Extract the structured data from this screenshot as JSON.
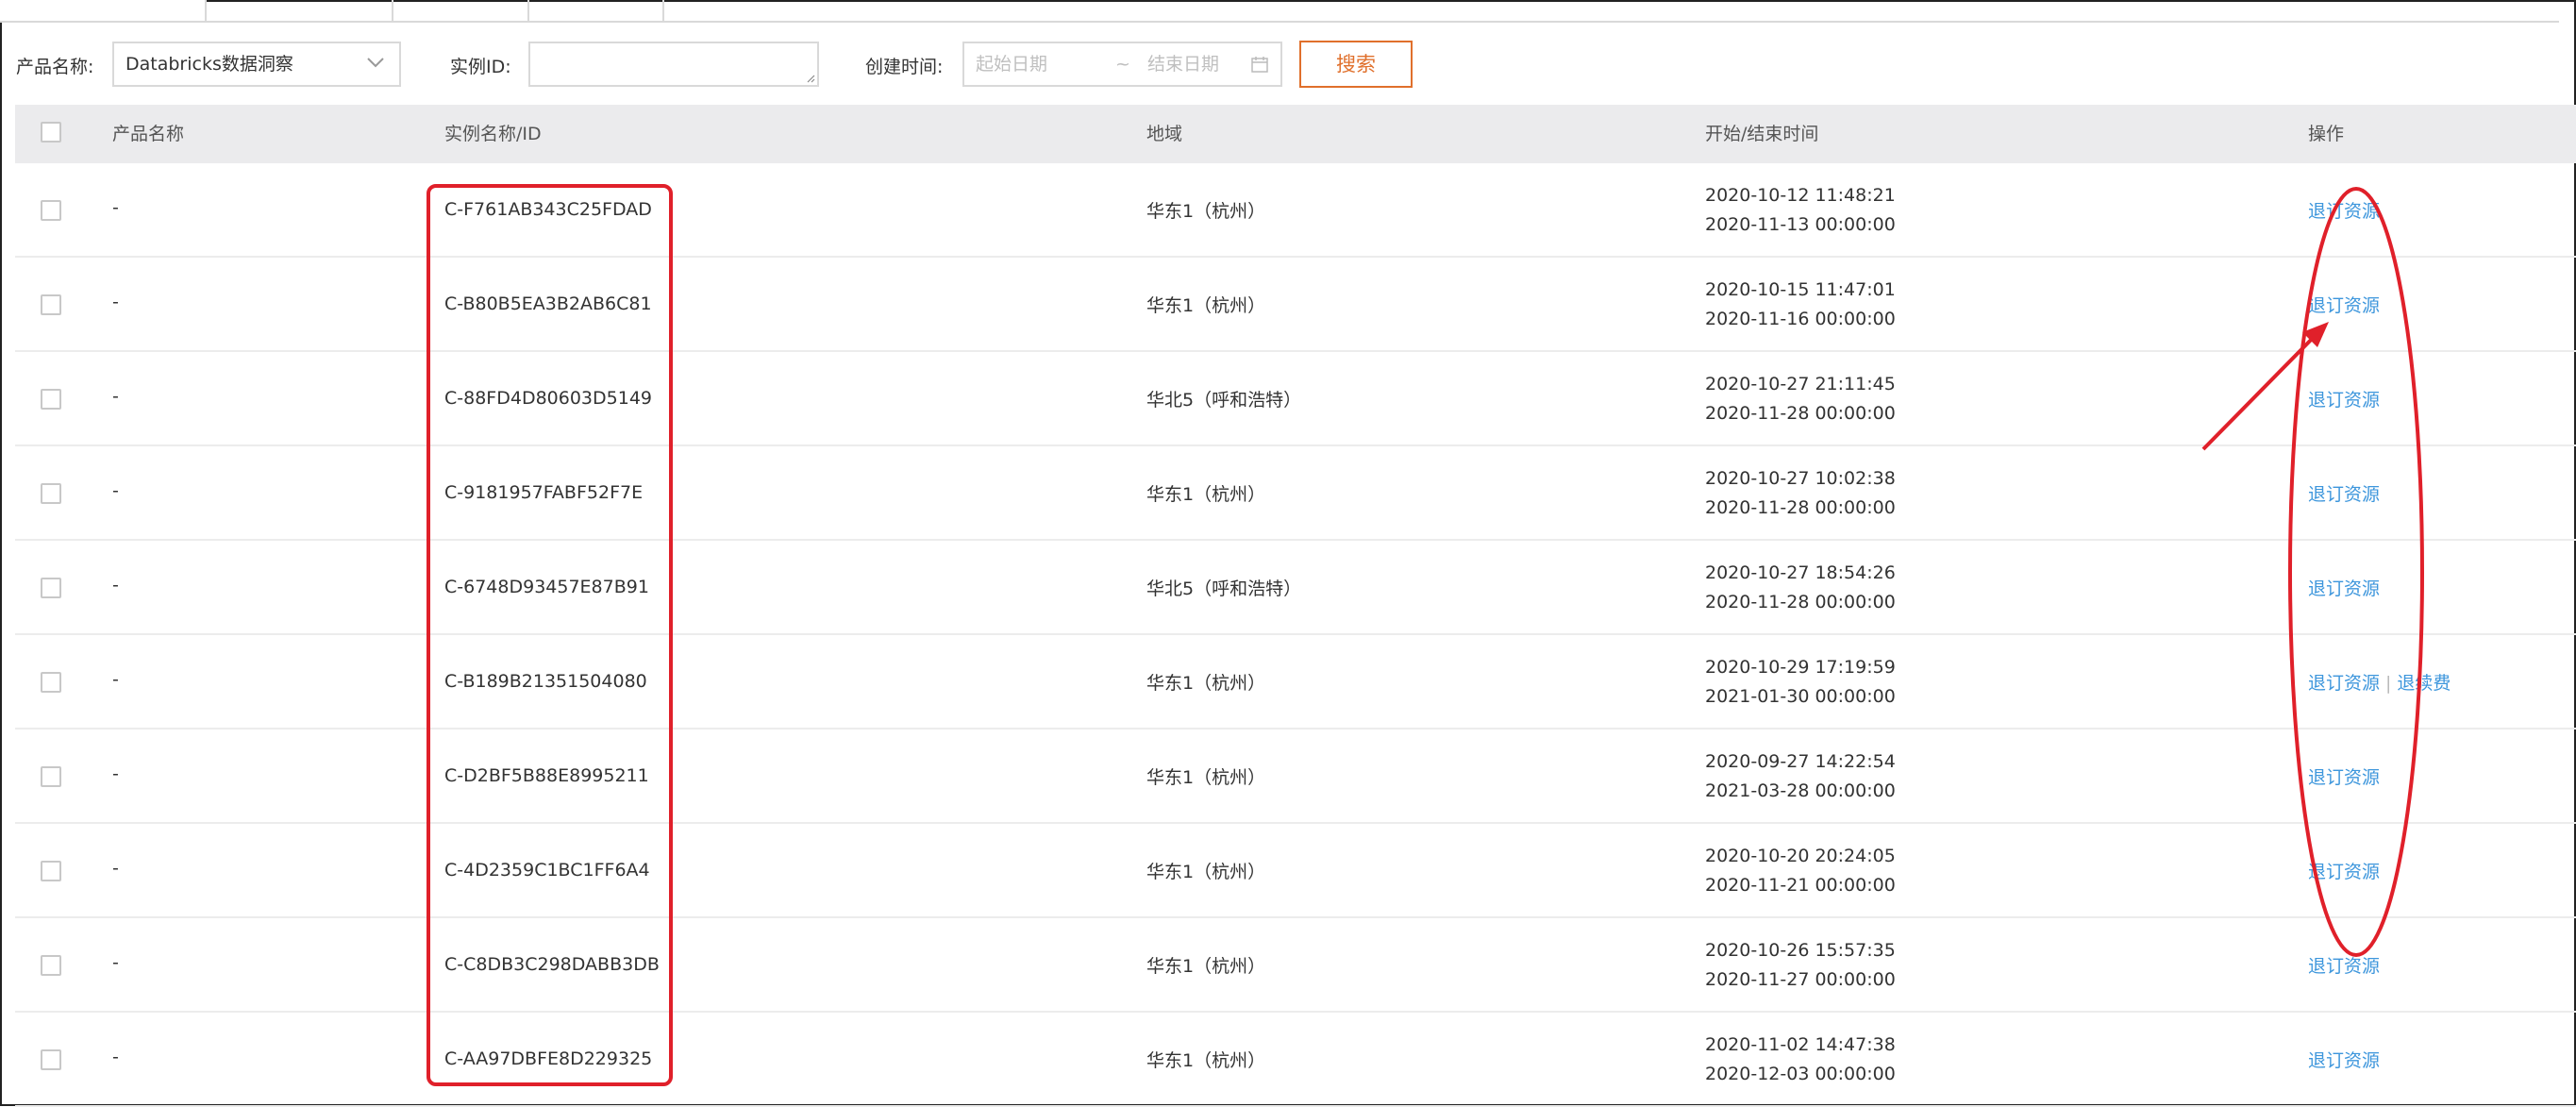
{
  "filters": {
    "product_label": "产品名称:",
    "product_value": "Databricks数据洞察",
    "instance_label": "实例ID:",
    "created_label": "创建时间:",
    "start_placeholder": "起始日期",
    "range_sep": "~",
    "end_placeholder": "结束日期",
    "search_label": "搜索"
  },
  "table": {
    "headers": {
      "product": "产品名称",
      "instance": "实例名称/ID",
      "region": "地域",
      "time": "开始/结束时间",
      "ops": "操作"
    },
    "rows": [
      {
        "product": "-",
        "id": "C-F761AB343C25FDAD",
        "region": "华东1（杭州）",
        "start": "2020-10-12 11:48:21",
        "end": "2020-11-13 00:00:00",
        "ops": [
          "退订资源"
        ]
      },
      {
        "product": "-",
        "id": "C-B80B5EA3B2AB6C81",
        "region": "华东1（杭州）",
        "start": "2020-10-15 11:47:01",
        "end": "2020-11-16 00:00:00",
        "ops": [
          "退订资源"
        ]
      },
      {
        "product": "-",
        "id": "C-88FD4D80603D5149",
        "region": "华北5（呼和浩特）",
        "start": "2020-10-27 21:11:45",
        "end": "2020-11-28 00:00:00",
        "ops": [
          "退订资源"
        ]
      },
      {
        "product": "-",
        "id": "C-9181957FABF52F7E",
        "region": "华东1（杭州）",
        "start": "2020-10-27 10:02:38",
        "end": "2020-11-28 00:00:00",
        "ops": [
          "退订资源"
        ]
      },
      {
        "product": "-",
        "id": "C-6748D93457E87B91",
        "region": "华北5（呼和浩特）",
        "start": "2020-10-27 18:54:26",
        "end": "2020-11-28 00:00:00",
        "ops": [
          "退订资源"
        ]
      },
      {
        "product": "-",
        "id": "C-B189B21351504080",
        "region": "华东1（杭州）",
        "start": "2020-10-29 17:19:59",
        "end": "2021-01-30 00:00:00",
        "ops": [
          "退订资源",
          "退续费"
        ]
      },
      {
        "product": "-",
        "id": "C-D2BF5B88E8995211",
        "region": "华东1（杭州）",
        "start": "2020-09-27 14:22:54",
        "end": "2021-03-28 00:00:00",
        "ops": [
          "退订资源"
        ]
      },
      {
        "product": "-",
        "id": "C-4D2359C1BC1FF6A4",
        "region": "华东1（杭州）",
        "start": "2020-10-20 20:24:05",
        "end": "2020-11-21 00:00:00",
        "ops": [
          "退订资源"
        ]
      },
      {
        "product": "-",
        "id": "C-C8DB3C298DABB3DB",
        "region": "华东1（杭州）",
        "start": "2020-10-26 15:57:35",
        "end": "2020-11-27 00:00:00",
        "ops": [
          "退订资源"
        ]
      },
      {
        "product": "-",
        "id": "C-AA97DBFE8D229325",
        "region": "华东1（杭州）",
        "start": "2020-11-02 14:47:38",
        "end": "2020-12-03 00:00:00",
        "ops": [
          "退订资源"
        ]
      }
    ]
  },
  "colors": {
    "link": "#3d96dc",
    "accent": "#e0702c",
    "annotation": "#e0202a",
    "header_bg": "#ebebed"
  },
  "icons": [
    "chevron-down-icon",
    "calendar-icon",
    "resize-grip-icon"
  ]
}
